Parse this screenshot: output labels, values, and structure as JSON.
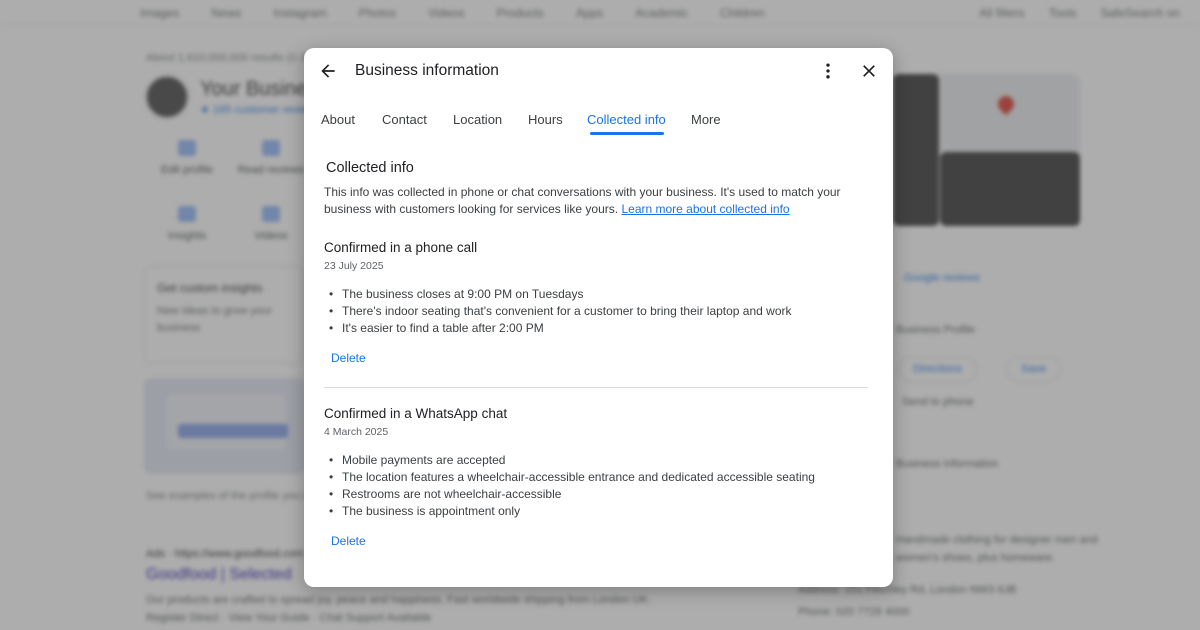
{
  "background": {
    "nav": [
      "Images",
      "News",
      "Instagram",
      "Photos",
      "Videos",
      "Products",
      "Apps",
      "Academic",
      "Children"
    ],
    "nav_right": [
      "All filters",
      "Tools",
      "SafeSearch on"
    ],
    "results_count": "About 1,610,000,000 results (0.38 seconds)",
    "business_name": "Your Business",
    "reviews": "★ 185 customer reviews",
    "actions": [
      "Edit profile",
      "Read reviews",
      "Insights",
      "Videos"
    ],
    "card_title": "Get custom insights",
    "card_sub": "New ideas to grow your business",
    "promo_caption": "See examples of the profile you can",
    "ad_url": "Ads · https://www.goodfood.com",
    "ad_link": "Goodfood | Selected",
    "ad_text1": "Our products are crafted to spread joy, peace and happiness. Fast worldwide shipping from London UK.",
    "ad_text2": "Register Direct · View Your Guide · Chat Support Available",
    "right_reviews": "Google reviews",
    "right_profile": "Business Profile",
    "right_chips": [
      "Directions",
      "Save"
    ],
    "right_send": "Send to phone",
    "right_info": "Business information",
    "right_desc1": "Handmade clothing for designer men and",
    "right_desc2": "women's shoes, plus homeware.",
    "right_address": "Address: 151 Finchley Rd, London NW3 6JB",
    "right_phone": "Phone: 020 7729 4000"
  },
  "dialog": {
    "title": "Business information",
    "tabs": [
      {
        "label": "About"
      },
      {
        "label": "Contact"
      },
      {
        "label": "Location"
      },
      {
        "label": "Hours"
      },
      {
        "label": "Collected info"
      },
      {
        "label": "More"
      }
    ],
    "active_tab": "Collected info",
    "section_title": "Collected info",
    "description": "This info was collected in phone or chat conversations with your business. It's used to match your business with customers looking for services like yours.",
    "learn_more": "Learn more about collected info",
    "entries": [
      {
        "title": "Confirmed in a phone call",
        "date": "23 July 2025",
        "items": [
          "The business closes at 9:00 PM on Tuesdays",
          "There's indoor seating that's convenient for a customer to bring their laptop and work",
          "It's easier to find a table after 2:00 PM"
        ],
        "delete_label": "Delete"
      },
      {
        "title": "Confirmed in a WhatsApp chat",
        "date": "4 March 2025",
        "items": [
          "Mobile payments are accepted",
          "The location features a wheelchair-accessible entrance and dedicated accessible seating",
          "Restrooms are not wheelchair-accessible",
          "The business is appointment only"
        ],
        "delete_label": "Delete"
      }
    ]
  },
  "icons": {
    "back": "arrow-left-icon",
    "more": "more-vert-icon",
    "close": "close-icon"
  },
  "colors": {
    "accent": "#1a73e8",
    "text": "#202124",
    "secondary_text": "#3c4043",
    "scrim": "rgba(0,0,0,0.32)"
  }
}
